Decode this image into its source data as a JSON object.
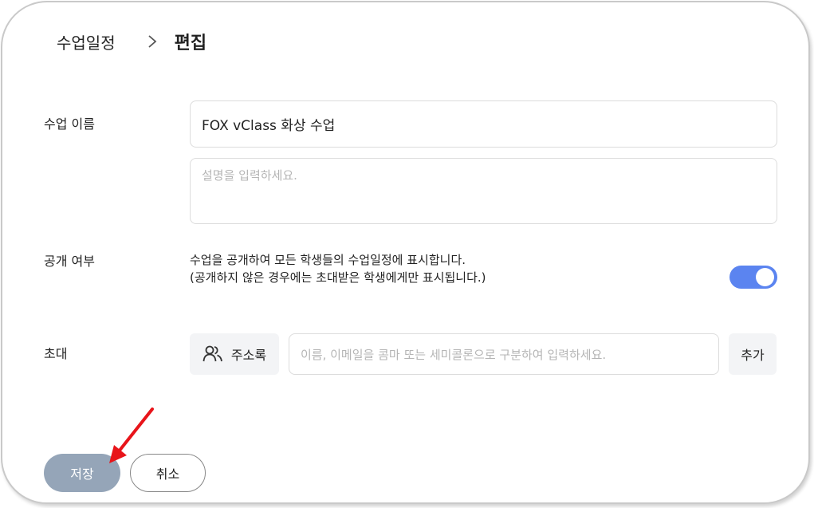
{
  "breadcrumb": {
    "parent": "수업일정",
    "current": "편집"
  },
  "form": {
    "name_label": "수업 이름",
    "name_value": "FOX vClass 화상 수업",
    "description_placeholder": "설명을 입력하세요.",
    "public_label": "공개 여부",
    "public_desc_line1": "수업을 공개하여 모든 학생들의 수업일정에 표시합니다.",
    "public_desc_line2": "(공개하지 않은 경우에는 초대받은 학생에게만 표시됩니다.)",
    "public_toggle_on": true,
    "invite_label": "초대",
    "address_book_label": "주소록",
    "invite_placeholder": "이름, 이메일을 콤마 또는 세미콜론으로 구분하여 입력하세요.",
    "add_label": "추가"
  },
  "actions": {
    "save_label": "저장",
    "cancel_label": "취소"
  },
  "colors": {
    "toggle_accent": "#5b84f0",
    "save_button": "#95a5b8",
    "annotation_arrow": "#e8141a"
  },
  "icons": {
    "separator": "chevron-right-icon",
    "address_book": "people-icon",
    "annotation": "red-arrow-icon"
  }
}
